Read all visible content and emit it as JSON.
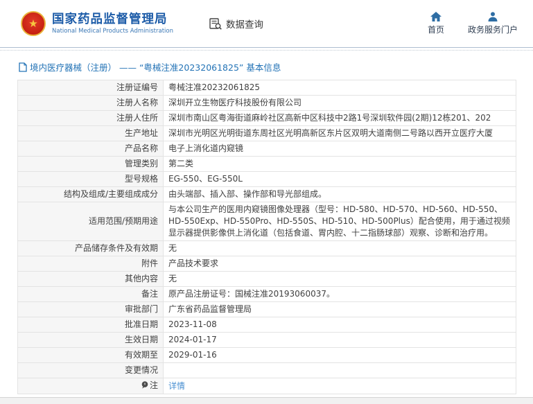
{
  "banner": {
    "title": "国家药品监督管理局",
    "subtitle": "National Medical Products Administration",
    "data_query_label": "数据查询",
    "nav": [
      {
        "label": "首页",
        "icon": "home-icon"
      },
      {
        "label": "政务服务门户",
        "icon": "person-icon"
      }
    ]
  },
  "breadcrumb": {
    "text": "境内医疗器械（注册） —— “粤械注准20232061825” 基本信息"
  },
  "table": {
    "rows": [
      {
        "label": "注册证编号",
        "value": "粤械注准20232061825"
      },
      {
        "label": "注册人名称",
        "value": "深圳开立生物医疗科技股份有限公司"
      },
      {
        "label": "注册人住所",
        "value": "深圳市南山区粤海街道麻岭社区高新中区科技中2路1号深圳软件园(2期)12栋201、202"
      },
      {
        "label": "生产地址",
        "value": "深圳市光明区光明街道东周社区光明高新区东片区双明大道南侧二号路以西开立医疗大厦"
      },
      {
        "label": "产品名称",
        "value": "电子上消化道内窥镜"
      },
      {
        "label": "管理类别",
        "value": "第二类"
      },
      {
        "label": "型号规格",
        "value": "EG-550、EG-550L"
      },
      {
        "label": "结构及组成/主要组成成分",
        "value": "由头端部、插入部、操作部和导光部组成。"
      },
      {
        "label": "适用范围/预期用途",
        "value": "与本公司生产的医用内窥镜图像处理器（型号：HD-580、HD-570、HD-560、HD-550、HD-550Exp、HD-550Pro、HD-550S、HD-510、HD-500Plus）配合使用，用于通过视频显示器提供影像供上消化道（包括食道、胃内腔、十二指肠球部）观察、诊断和治疗用。"
      },
      {
        "label": "产品储存条件及有效期",
        "value": "无"
      },
      {
        "label": "附件",
        "value": "产品技术要求"
      },
      {
        "label": "其他内容",
        "value": "无"
      },
      {
        "label": "备注",
        "value": "原产品注册证号：国械注准20193060037。"
      },
      {
        "label": "审批部门",
        "value": "广东省药品监督管理局"
      },
      {
        "label": "批准日期",
        "value": "2023-11-08"
      },
      {
        "label": "生效日期",
        "value": "2024-01-17"
      },
      {
        "label": "有效期至",
        "value": "2029-01-16"
      },
      {
        "label": "变更情况",
        "value": ""
      },
      {
        "label": "注",
        "value": "详情",
        "link": true,
        "label_icon": "note-balloon-icon"
      }
    ]
  },
  "colors": {
    "brand_blue": "#1d5ca8",
    "nav_icon_blue": "#2e6da4",
    "breadcrumb_blue": "#2373b6",
    "link_blue": "#4a90d2",
    "emblem_red": "#c41f10",
    "emblem_gold": "#e9b53c",
    "label_cell_bg": "#f6f6f6",
    "table_border": "#d9d9d9"
  }
}
